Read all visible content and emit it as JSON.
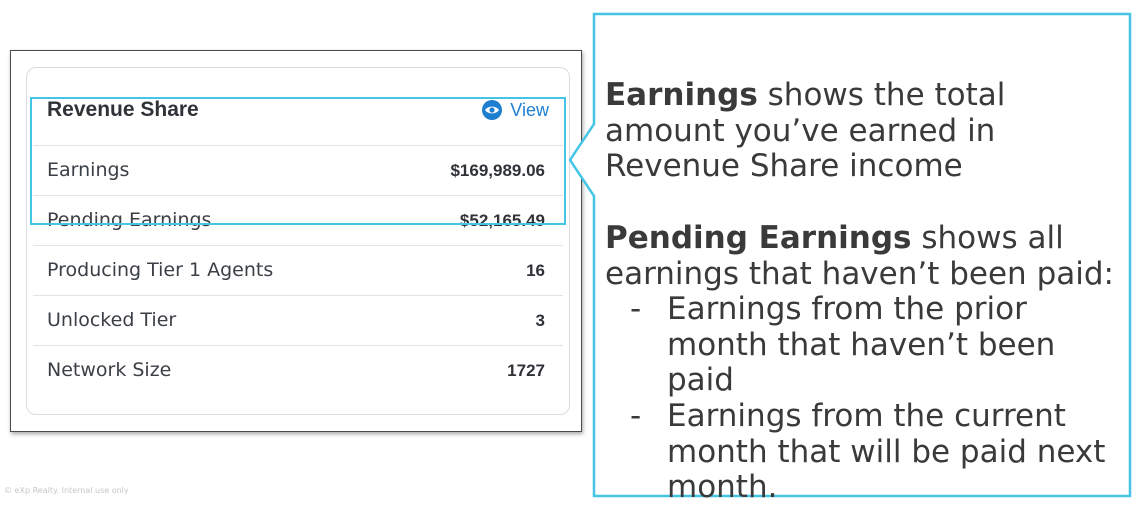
{
  "card": {
    "title": "Revenue Share",
    "view_label": "View",
    "view_icon": "eye-icon",
    "accent_color": "#1e7fd1",
    "rows": [
      {
        "label": "Earnings",
        "value": "$169,989.06"
      },
      {
        "label": "Pending Earnings",
        "value": "$52,165.49"
      },
      {
        "label": "Producing Tier 1 Agents",
        "value": "16"
      },
      {
        "label": "Unlocked Tier",
        "value": "3"
      },
      {
        "label": "Network Size",
        "value": "1727"
      }
    ]
  },
  "callout": {
    "border_color": "#45c5e6",
    "earnings_term": "Earnings",
    "earnings_text": " shows the total amount you’ve earned in Revenue Share income",
    "pending_term": "Pending Earnings",
    "pending_text": " shows all earnings that haven’t been paid:",
    "bullets": [
      "Earnings from the prior month that haven’t been paid",
      "Earnings from the current month that will be paid next month."
    ],
    "bullet_marker": "-"
  },
  "footnote": "© eXp Realty. Internal use only"
}
